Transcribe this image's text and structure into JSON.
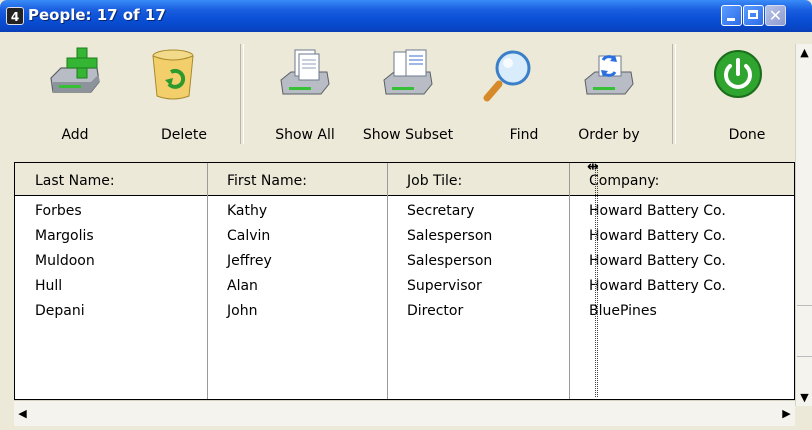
{
  "window": {
    "title": "People: 17 of 17"
  },
  "toolbar": {
    "add": "Add",
    "delete": "Delete",
    "show_all": "Show All",
    "show_subset": "Show Subset",
    "find": "Find",
    "order_by": "Order by",
    "done": "Done"
  },
  "table": {
    "columns": [
      "Last Name:",
      "First Name:",
      "Job Tile:",
      "Company:"
    ],
    "rows": [
      [
        "Forbes",
        "Kathy",
        "Secretary",
        "Howard Battery Co."
      ],
      [
        "Margolis",
        "Calvin",
        "Salesperson",
        "Howard Battery Co."
      ],
      [
        "Muldoon",
        "Jeffrey",
        "Salesperson",
        "Howard Battery Co."
      ],
      [
        "Hull",
        "Alan",
        "Supervisor",
        "Howard Battery Co."
      ],
      [
        "Depani",
        "John",
        "Director",
        "BluePines"
      ]
    ]
  },
  "icons": {
    "app": "4d-app-icon",
    "add": "drive-plus-icon",
    "delete": "recycle-bin-icon",
    "show_all": "drive-documents-icon",
    "show_subset": "drive-documents-subset-icon",
    "find": "magnifier-icon",
    "order_by": "drive-sort-icon",
    "done": "power-icon"
  },
  "colors": {
    "titlebar": "#0a4fd6",
    "done_green": "#2fa52f",
    "add_green": "#38b838"
  }
}
